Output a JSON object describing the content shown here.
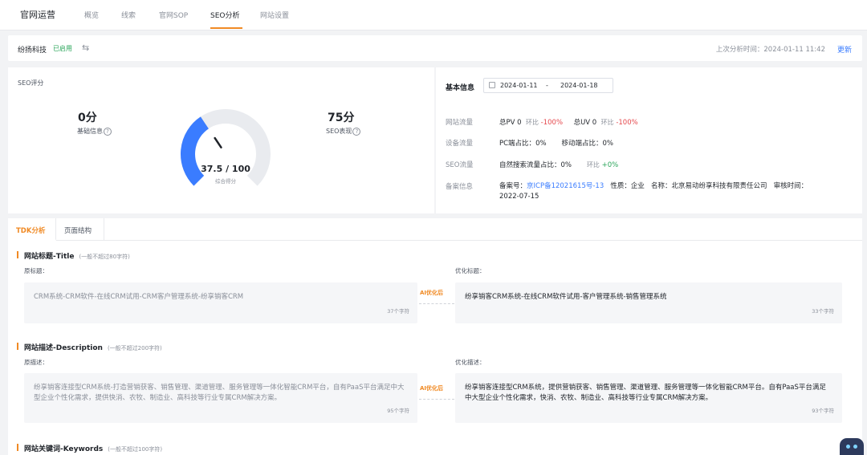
{
  "topnav": {
    "brand": "官网运营",
    "tabs": [
      "概览",
      "线索",
      "官网SOP",
      "SEO分析",
      "网站设置"
    ],
    "active_tab": "SEO分析"
  },
  "bar": {
    "company": "纷扬科技",
    "status": "已启用",
    "switch_icon": "⇆",
    "last_analysis": "上次分析时间：2024-01-11 11:42",
    "update": "更新"
  },
  "score": {
    "title": "SEO评分",
    "basic_value": "0分",
    "basic_label": "基础信息",
    "seo_value": "75分",
    "seo_label": "SEO表现",
    "total": "37.5 / 100",
    "total_label": "综合得分",
    "gauge_fraction": 0.375
  },
  "info": {
    "title": "基本信息",
    "date_from": "2024-01-11",
    "date_sep": "-",
    "date_to": "2024-01-18",
    "rows": [
      {
        "label": "网站流量",
        "a": "总PV 0",
        "a_ratio": "环比",
        "a_val": "-100%",
        "b": "总UV 0",
        "b_ratio": "环比",
        "b_val": "-100%"
      },
      {
        "label": "设备流量",
        "a": "PC端占比：",
        "a_val": "0%",
        "b": "移动端占比：",
        "b_val": "0%"
      },
      {
        "label": "SEO流量",
        "a": "自然搜索流量占比：",
        "a_val": "0%",
        "b": "环比",
        "b_val": "+0%"
      },
      {
        "label": "备案信息",
        "record": "备案号：",
        "record_link": "京ICP备12021615号-13",
        "nature": "性质：企业",
        "name": "名称：北京易动纷享科技有限责任公司",
        "audit": "审核时间：",
        "audit_date": "2022-07-15"
      }
    ]
  },
  "tdk": {
    "tabs": [
      "TDK分析",
      "页面结构"
    ],
    "sections": [
      {
        "title": "网站标题-Title",
        "hint": "(一般不超过80字符)",
        "orig_label": "原标题：",
        "opt_label": "优化标题：",
        "orig": "CRM系统-CRM软件-在线CRM试用-CRM客户管理系统-纷享销客CRM",
        "orig_count": "37个字符",
        "opt": "纷享销客CRM系统-在线CRM软件试用-客户管理系统-销售管理系统",
        "opt_count": "33个字符",
        "ai": "AI优化后"
      },
      {
        "title": "网站描述-Description",
        "hint": "(一般不超过200字符)",
        "orig_label": "原描述：",
        "opt_label": "优化描述：",
        "orig": "纷享销客连接型CRM系统-打造营销获客、销售管理、渠道管理、服务管理等一体化智能CRM平台，自有PaaS平台满足中大型企业个性化需求，提供快消、农牧、制造业、高科技等行业专属CRM解决方案。",
        "orig_count": "95个字符",
        "opt": "纷享销客连接型CRM系统，提供营销获客、销售管理、渠道管理、服务管理等一体化智能CRM平台。自有PaaS平台满足中大型企业个性化需求，快消、农牧、制造业、高科技等行业专属CRM解决方案。",
        "opt_count": "93个字符",
        "ai": "AI优化后"
      },
      {
        "title": "网站关键词-Keywords",
        "hint": "(一般不超过100字符)"
      }
    ]
  },
  "colors": {
    "accent": "#f08a24",
    "gauge_fill": "#3a7cff",
    "gauge_track": "#e9ebef",
    "link": "#3a7cff",
    "up": "#2aa55a",
    "down": "#e5484d"
  }
}
